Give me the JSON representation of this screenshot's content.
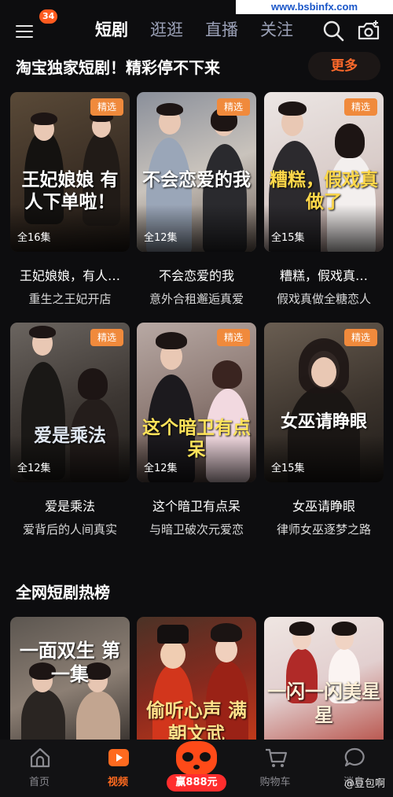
{
  "watermark": "www.bsbinfx.com",
  "header": {
    "badge_count": "34",
    "tabs": [
      {
        "label": "短剧",
        "active": true
      },
      {
        "label": "逛逛",
        "active": false
      },
      {
        "label": "直播",
        "active": false
      },
      {
        "label": "关注",
        "active": false
      }
    ]
  },
  "section1": {
    "title": "淘宝独家短剧！精彩停不下来",
    "more_label": "更多",
    "tag_label": "精选",
    "cards": [
      {
        "poster_title": "王妃娘娘 有人下单啦！",
        "episodes": "全16集",
        "name": "王妃娘娘，有人…",
        "subtitle": "重生之王妃开店"
      },
      {
        "poster_title": "不会恋爱的我",
        "episodes": "全12集",
        "name": "不会恋爱的我",
        "subtitle": "意外合租邂逅真爱"
      },
      {
        "poster_title": "糟糕，假戏真做了",
        "episodes": "全15集",
        "name": "糟糕，假戏真…",
        "subtitle": "假戏真做全糖恋人"
      },
      {
        "poster_title": "爱是乘法",
        "episodes": "全12集",
        "name": "爱是乘法",
        "subtitle": "爱背后的人间真实"
      },
      {
        "poster_title": "这个暗卫有点呆",
        "episodes": "全12集",
        "name": "这个暗卫有点呆",
        "subtitle": "与暗卫破次元爱恋"
      },
      {
        "poster_title": "女巫请睁眼",
        "episodes": "全15集",
        "name": "女巫请睁眼",
        "subtitle": "律师女巫逐梦之路"
      }
    ]
  },
  "section2": {
    "title": "全网短剧热榜",
    "cards": [
      {
        "poster_title": "一面双生 第一集"
      },
      {
        "poster_title": "偷听心声 满朝文武"
      },
      {
        "poster_title": "一闪一闪美星星"
      }
    ]
  },
  "bottom_nav": {
    "items": [
      {
        "label": "首页",
        "icon": "home-icon",
        "active": false
      },
      {
        "label": "视频",
        "icon": "video-icon",
        "active": true
      },
      {
        "label": "购物车",
        "icon": "cart-icon",
        "active": false
      },
      {
        "label": "消息",
        "icon": "message-icon",
        "active": false
      }
    ],
    "promo_amount": "赢888元"
  },
  "uploader": "@豆包啊",
  "colors": {
    "accent": "#ff6a1f",
    "background": "#0d0d0f",
    "tag": "#f08a3c"
  }
}
